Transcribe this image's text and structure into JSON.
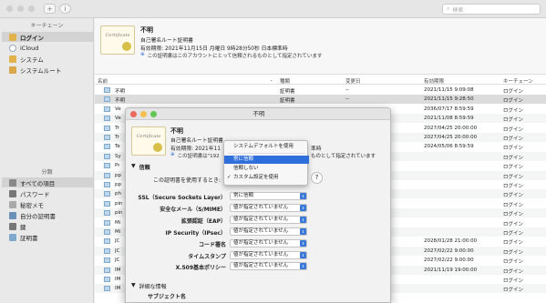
{
  "toolbar": {
    "add_icon": "+",
    "info_icon": "i",
    "search_placeholder": "検索"
  },
  "sidebar": {
    "keychain_header": "キーチェーン",
    "keychains": [
      {
        "label": "ログイン",
        "icon": "lock-open-icon"
      },
      {
        "label": "iCloud",
        "icon": "cloud-icon"
      },
      {
        "label": "システム",
        "icon": "lock-icon"
      },
      {
        "label": "システムルート",
        "icon": "cabinet-icon"
      }
    ],
    "category_header": "分類",
    "categories": [
      {
        "label": "すべての項目",
        "icon": "all-items-icon"
      },
      {
        "label": "パスワード",
        "icon": "key-icon"
      },
      {
        "label": "秘密メモ",
        "icon": "note-icon"
      },
      {
        "label": "自分の証明書",
        "icon": "my-cert-icon"
      },
      {
        "label": "鍵",
        "icon": "key2-icon"
      },
      {
        "label": "証明書",
        "icon": "cert-icon"
      }
    ]
  },
  "cert_summary": {
    "image_text": "Certificate",
    "name": "不明",
    "kind": "自己署名ルート証明書",
    "expires": "有効期限: 2021年11月15日 月曜日 9時28分50秒 日本標準時",
    "trust_note": "この証明書はこのアカウントにとって信頼されるものとして指定されています"
  },
  "table": {
    "headers": [
      "名前",
      "種類",
      "変更日",
      "有効期限",
      "キーチェーン"
    ],
    "rows": [
      [
        "不明",
        "証明書",
        "--",
        "2021/11/15 9:09:08",
        "ログイン"
      ],
      [
        "不明",
        "証明書",
        "--",
        "2021/11/15 9:28:50",
        "ログイン"
      ],
      [
        "Ve",
        "",
        "",
        "2036/07/17 8:59:59",
        "ログイン"
      ],
      [
        "Ve",
        "",
        "",
        "2021/11/08 8:59:59",
        "ログイン"
      ],
      [
        "Tr",
        "",
        "",
        "2027/04/25 20:00:00",
        "ログイン"
      ],
      [
        "Tr",
        "",
        "",
        "2027/04/25 20:00:00",
        "ログイン"
      ],
      [
        "Te",
        "",
        "",
        "2024/05/06 8:59:59",
        "ログイン"
      ],
      [
        "Sy",
        "",
        "",
        "",
        "ログイン"
      ],
      [
        "Pr",
        "",
        ":21",
        "",
        "ログイン"
      ],
      [
        "pp",
        "",
        ":56",
        "",
        "ログイン"
      ],
      [
        "pp",
        "",
        ":07",
        "",
        "ログイン"
      ],
      [
        "ph",
        "",
        ":11",
        "",
        "ログイン"
      ],
      [
        "pin",
        "",
        ":28",
        "",
        "ログイン"
      ],
      [
        "pin",
        "",
        ":33",
        "",
        "ログイン"
      ],
      [
        "Mi",
        "",
        ":41",
        "",
        "ログイン"
      ],
      [
        "Mi",
        "",
        ":17",
        "",
        "ログイン"
      ],
      [
        "JC",
        "",
        "",
        "2028/01/28 21:00:00",
        "ログイン"
      ],
      [
        "JC",
        "",
        "",
        "2027/02/22 9:00:00",
        "ログイン"
      ],
      [
        "JC",
        "",
        "",
        "2027/02/22 9:00:00",
        "ログイン"
      ],
      [
        "IM",
        "",
        "",
        "2021/11/19 19:00:00",
        "ログイン"
      ],
      [
        "IM",
        "",
        "",
        "",
        "ログイン"
      ],
      [
        "IM",
        "",
        "",
        "",
        "ログイン"
      ]
    ]
  },
  "dialog": {
    "title": "不明",
    "cert_name": "不明",
    "cert_kind": "自己署名ルート証明書",
    "expires": "有効期限: 2021年11",
    "expires_tail": "準時",
    "trust_prefix": "この証明書は\"192",
    "trust_suffix": "ものとして指定されています",
    "trust_section": "信頼",
    "when_using_label": "この証明書を使用するとき:",
    "help": "?",
    "settings": [
      {
        "label": "SSL（Secure Sockets Layer）",
        "value": "常に信頼"
      },
      {
        "label": "安全なメール（S/MIME）",
        "value": "値が指定されていません"
      },
      {
        "label": "拡張認証（EAP）",
        "value": "値が指定されていません"
      },
      {
        "label": "IP Security（IPsec）",
        "value": "値が指定されていません"
      },
      {
        "label": "コード署名",
        "value": "値が指定されていません"
      },
      {
        "label": "タイムスタンプ",
        "value": "値が指定されていません"
      },
      {
        "label": "X.509基本ポリシー",
        "value": "値が指定されていません"
      }
    ],
    "details_section": "詳細な情報",
    "subject_name": "サブジェクト名"
  },
  "menu": {
    "items": [
      "システムデフォルトを使用",
      "常に信頼",
      "信頼しない",
      "カスタム設定を使用"
    ],
    "checked": "✓"
  },
  "colors": {
    "highlight": "#2f6fdb",
    "accent": "#3a78d8"
  }
}
